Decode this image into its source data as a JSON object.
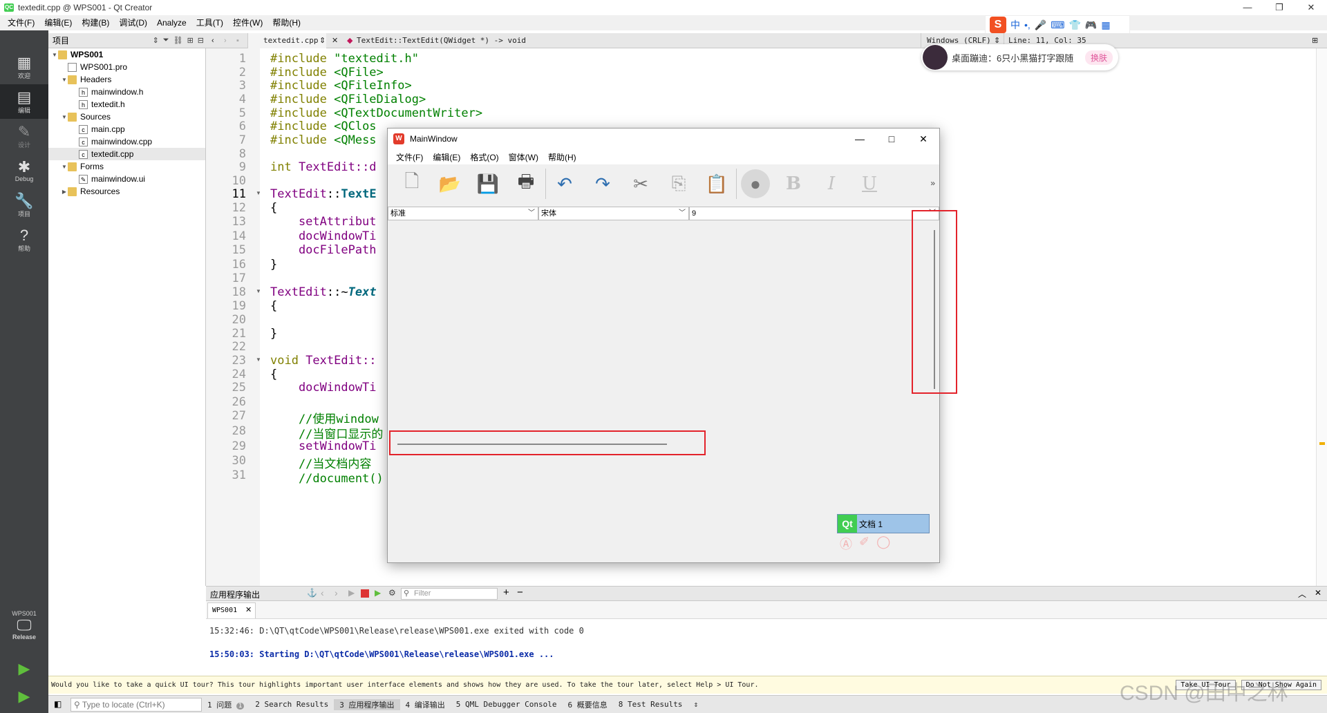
{
  "window": {
    "title": "textedit.cpp @ WPS001 - Qt Creator",
    "min": "—",
    "max": "❐",
    "close": "✕"
  },
  "menubar": [
    "文件(F)",
    "编辑(E)",
    "构建(B)",
    "调试(D)",
    "Analyze",
    "工具(T)",
    "控件(W)",
    "帮助(H)"
  ],
  "modes": [
    {
      "label": "欢迎",
      "icon": "grid-icon"
    },
    {
      "label": "编辑",
      "icon": "edit-icon"
    },
    {
      "label": "设计",
      "icon": "pencil-icon"
    },
    {
      "label": "Debug",
      "icon": "bug-icon"
    },
    {
      "label": "项目",
      "icon": "wrench-icon"
    },
    {
      "label": "帮助",
      "icon": "help-icon"
    }
  ],
  "kit": {
    "project": "WPS001",
    "config": "Release"
  },
  "project_panel": {
    "title": "项目",
    "tree": [
      {
        "label": "WPS001",
        "kind": "project"
      },
      {
        "label": "WPS001.pro",
        "kind": "file"
      },
      {
        "label": "Headers",
        "kind": "folder"
      },
      {
        "label": "mainwindow.h",
        "kind": "file"
      },
      {
        "label": "textedit.h",
        "kind": "file"
      },
      {
        "label": "Sources",
        "kind": "folder"
      },
      {
        "label": "main.cpp",
        "kind": "file"
      },
      {
        "label": "mainwindow.cpp",
        "kind": "file"
      },
      {
        "label": "textedit.cpp",
        "kind": "file"
      },
      {
        "label": "Forms",
        "kind": "folder"
      },
      {
        "label": "mainwindow.ui",
        "kind": "file"
      },
      {
        "label": "Resources",
        "kind": "folder"
      }
    ]
  },
  "editor_toolbar": {
    "file": "textedit.cpp",
    "symbol": "TextEdit::TextEdit(QWidget *) -> void",
    "encoding": "Windows (CRLF)",
    "position": "Line: 11, Col: 35"
  },
  "line_numbers": [
    "1",
    "2",
    "3",
    "4",
    "5",
    "6",
    "7",
    "8",
    "9",
    "10",
    "11",
    "12",
    "13",
    "14",
    "15",
    "16",
    "17",
    "18",
    "19",
    "20",
    "21",
    "22",
    "23",
    "24",
    "25",
    "26",
    "27",
    "28",
    "29",
    "30",
    "31"
  ],
  "code": {
    "l1": [
      "#include ",
      "\"textedit.h\""
    ],
    "l2": [
      "#include ",
      "<QFile>"
    ],
    "l3": [
      "#include ",
      "<QFileInfo>"
    ],
    "l4": [
      "#include ",
      "<QFileDialog>"
    ],
    "l5": [
      "#include ",
      "<QTextDocumentWriter>"
    ],
    "l6": [
      "#include ",
      "<QClos"
    ],
    "l7": [
      "#include ",
      "<QMess"
    ],
    "l9": [
      "int",
      " TextEdit::d"
    ],
    "l11": [
      "TextEdit",
      "::",
      "TextE"
    ],
    "l12": "{",
    "l13": "    setAttribut",
    "l14": "    docWindowTi",
    "l15": "    docFilePath",
    "l16": "}",
    "l18": [
      "TextEdit",
      "::~",
      "Text"
    ],
    "l19": "{",
    "l21": "}",
    "l23": [
      "void",
      " TextEdit::"
    ],
    "l24": "{",
    "l25": "    docWindowTi",
    "l27": "    //使用window",
    "l28": "    //当窗口显示的",
    "l29": "    setWindowTi",
    "l30": "    //当文档内容",
    "l31": "    //document() 返回当前TextEdit文档"
  },
  "ime": {
    "logo": "S",
    "items": [
      "中",
      "•,",
      "🎤",
      "⌨",
      "👕",
      "🎮",
      "▦"
    ]
  },
  "notice": {
    "text": "桌面蹦迪：6只小黑猫打字跟随",
    "action": "换肤"
  },
  "mainwindow": {
    "title": "MainWindow",
    "menu": [
      "文件(F)",
      "编辑(E)",
      "格式(O)",
      "窗体(W)",
      "帮助(H)"
    ],
    "tools": [
      {
        "name": "new-icon",
        "glyph": "🗋"
      },
      {
        "name": "open-icon",
        "glyph": "📂"
      },
      {
        "name": "save-icon",
        "glyph": "💾"
      },
      {
        "name": "print-icon",
        "glyph": "🖶"
      },
      {
        "name": "undo-icon",
        "glyph": "↶"
      },
      {
        "name": "redo-icon",
        "glyph": "↷"
      },
      {
        "name": "cut-icon",
        "glyph": "✂"
      },
      {
        "name": "copy-icon",
        "glyph": "⎘"
      },
      {
        "name": "paste-icon",
        "glyph": "📋"
      },
      {
        "name": "color-icon",
        "glyph": "●"
      },
      {
        "name": "bold-icon",
        "glyph": "B"
      },
      {
        "name": "italic-icon",
        "glyph": "I"
      },
      {
        "name": "underline-icon",
        "glyph": "U"
      }
    ],
    "more": "»",
    "style_combo": "标准",
    "font_combo": "宋体",
    "size_combo": "9",
    "doc_tab": "文档 1",
    "doc_tab_logo": "Qt"
  },
  "output": {
    "title": "应用程序输出",
    "filter_placeholder": "Filter",
    "tab": "WPS001",
    "lines": [
      "15:32:46: D:\\QT\\qtCode\\WPS001\\Release\\release\\WPS001.exe exited with code 0",
      "15:50:03: Starting D:\\QT\\qtCode\\WPS001\\Release\\release\\WPS001.exe ..."
    ]
  },
  "tour": {
    "message": "Would you like to take a quick UI tour? This tour highlights important user interface elements and shows how they are used. To take the tour later, select Help > UI Tour.",
    "take": "Take UI Tour",
    "dismiss": "Do Not Show Again"
  },
  "statusbar": {
    "locator_placeholder": "Type to locate (Ctrl+K)",
    "panes": [
      "1 问题",
      "2 Search Results",
      "3 应用程序输出",
      "4 编译输出",
      "5 QML Debugger Console",
      "6 概要信息",
      "8 Test Results"
    ],
    "issues_count": "1"
  },
  "watermark": "CSDN @田中之林"
}
